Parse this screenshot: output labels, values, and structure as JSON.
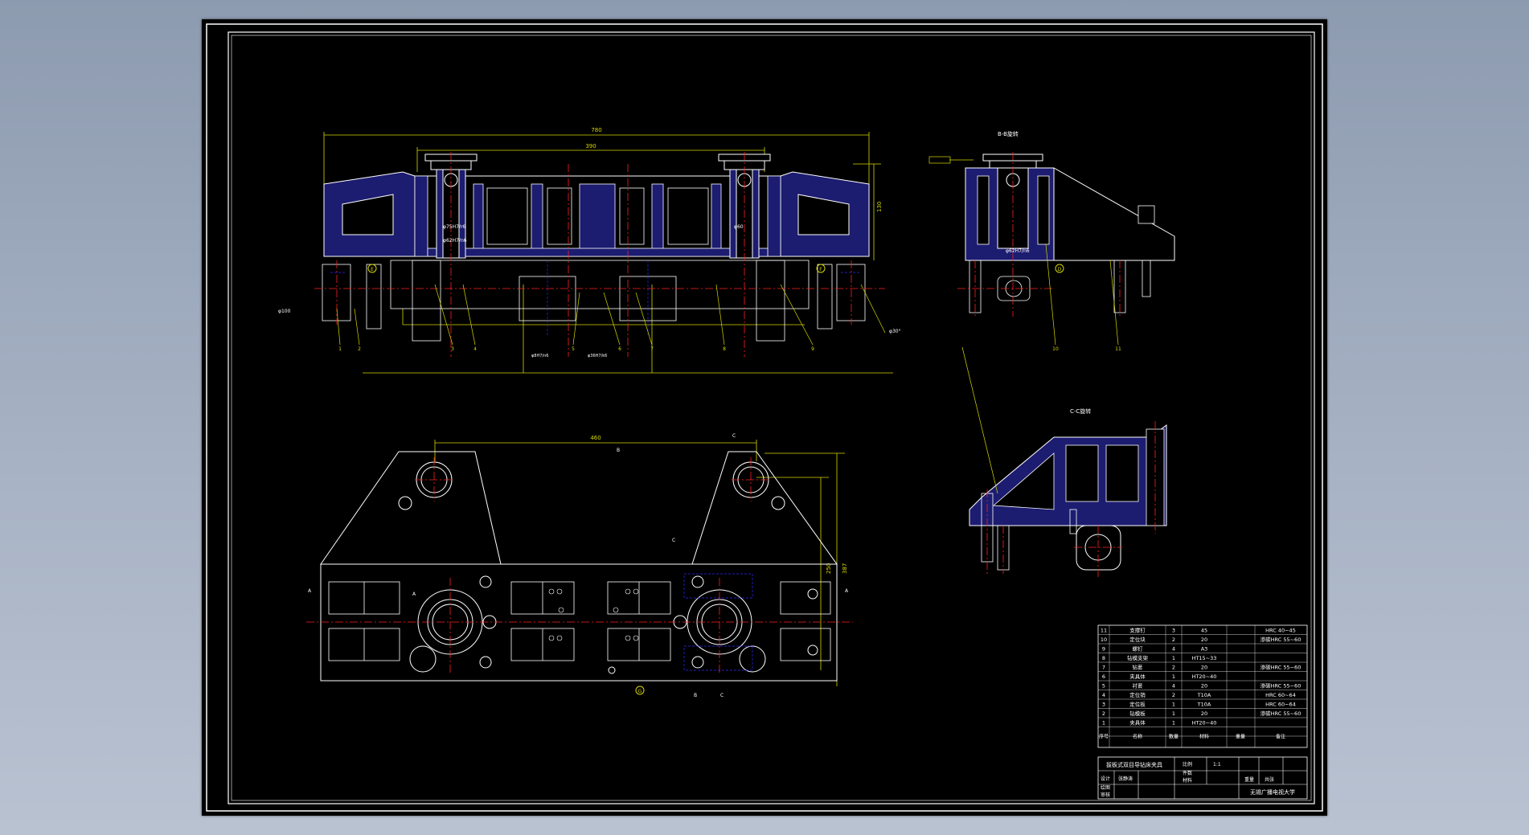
{
  "views": {
    "section_b_title": "B-B旋转",
    "section_c_title": "C-C旋转"
  },
  "dimensions": {
    "overall_length": "780",
    "inner_length": "390",
    "height_right": "130",
    "plan_length": "460",
    "plan_height": "250",
    "plan_height_total": "387",
    "bore_fit_1": "φ75H7/r6",
    "bore_fit_2": "φ62H7/n6",
    "bore_fit_3": "φ62H7/n6",
    "detail_left": "φ100",
    "detail_right": "φ30°",
    "note_bottom_1": "φ8H7/n6",
    "note_bottom_2": "φ36H7/k6",
    "mid_dim": "φ60",
    "section_mark_a": "A",
    "section_mark_b": "B",
    "section_mark_c": "C",
    "circle_e": "E",
    "circle_f": "F",
    "circle_g": "G",
    "circle_d": "D"
  },
  "balloons": [
    "1",
    "2",
    "3",
    "4",
    "5",
    "6",
    "7",
    "8",
    "9",
    "10",
    "11"
  ],
  "parts_list": {
    "rows": [
      {
        "no": "11",
        "name": "支撑钉",
        "qty": "3",
        "material": "45",
        "note": "HRC 40~45"
      },
      {
        "no": "10",
        "name": "定位块",
        "qty": "2",
        "material": "20",
        "note": "渗碳HRC 55~60"
      },
      {
        "no": "9",
        "name": "螺钉",
        "qty": "4",
        "material": "A3",
        "note": ""
      },
      {
        "no": "8",
        "name": "钻模支架",
        "qty": "1",
        "material": "HT15~33",
        "note": ""
      },
      {
        "no": "7",
        "name": "钻套",
        "qty": "2",
        "material": "20",
        "note": "渗碳HRC 55~60"
      },
      {
        "no": "6",
        "name": "夹具体",
        "qty": "1",
        "material": "HT20~40",
        "note": ""
      },
      {
        "no": "5",
        "name": "衬套",
        "qty": "4",
        "material": "20",
        "note": "渗碳HRC 55~60"
      },
      {
        "no": "4",
        "name": "定位销",
        "qty": "2",
        "material": "T10A",
        "note": "HRC 60~64"
      },
      {
        "no": "3",
        "name": "定位板",
        "qty": "1",
        "material": "T10A",
        "note": "HRC 60~64"
      },
      {
        "no": "2",
        "name": "钻模板",
        "qty": "1",
        "material": "20",
        "note": "渗碳HRC 55~60"
      },
      {
        "no": "1",
        "name": "夹具体",
        "qty": "1",
        "material": "HT20~40",
        "note": ""
      }
    ],
    "header": {
      "no": "序号",
      "name": "名称",
      "qty": "数量",
      "material": "材料",
      "weight": "重量",
      "note": "备注"
    }
  },
  "title_block": {
    "drawing_title": "拔板式双目导钻床夹具",
    "scale_label": "比例",
    "scale_value": "1:1",
    "quantity_label": "件数",
    "material_label": "材料",
    "weight_label": "重量",
    "sheet_label": "共张",
    "designer_label": "设计",
    "designer_name": "张静涛",
    "drawn_label": "绘图",
    "review_label": "审核",
    "school": "无锡广播电视大学"
  },
  "colors": {
    "border": "#ffffff",
    "outline": "#ffffff",
    "dimension": "#d7d700",
    "centerline": "#ff2020",
    "section_fill": "#1c1c70",
    "hidden": "#2a2aff"
  }
}
